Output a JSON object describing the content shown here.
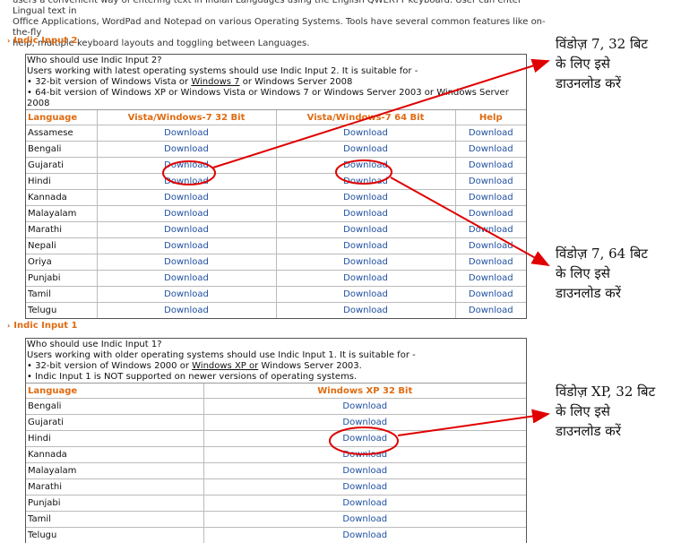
{
  "intro": {
    "line1": "users a convenient way of entering text in Indian Languages using the English QWERTY keyboard. User can enter Lingual text in",
    "line2": "Office Applications, WordPad and Notepad on various Operating Systems. Tools have several common features like on-the-fly",
    "line3": "help, multiple keyboard layouts and toggling between Languages."
  },
  "indic2": {
    "title": "Indic Input 2",
    "info_line1": "Who should use Indic Input 2?",
    "info_line2": "Users working with latest operating systems should use Indic Input 2. It is suitable for -",
    "bullet1_pre": "• 32-bit version of Windows Vista or ",
    "bullet1_ul": "Windows 7",
    "bullet1_post": " or Windows Server 2008",
    "bullet2": "• 64-bit version of Windows XP or Windows Vista or Windows 7 or Windows Server 2003 or Windows Server 2008",
    "headers": [
      "Language",
      "Vista/Windows-7 32 Bit",
      "Vista/Windows-7 64 Bit",
      "Help"
    ],
    "download_label": "Download",
    "languages": [
      "Assamese",
      "Bengali",
      "Gujarati",
      "Hindi",
      "Kannada",
      "Malayalam",
      "Marathi",
      "Nepali",
      "Oriya",
      "Punjabi",
      "Tamil",
      "Telugu"
    ]
  },
  "indic1": {
    "title": "Indic Input 1",
    "info_line1": "Who should use Indic Input 1?",
    "info_line2": "Users working with older operating systems should use Indic Input 1. It is suitable for -",
    "bullet1_pre": "• 32-bit version of Windows 2000 or ",
    "bullet1_ul": "Windows XP or",
    "bullet1_post": " Windows Server 2003.",
    "bullet2": "• Indic Input 1 is NOT supported on newer versions of operating systems.",
    "headers": [
      "Language",
      "Windows XP 32 Bit"
    ],
    "download_label": "Download",
    "languages": [
      "Bengali",
      "Gujarati",
      "Hindi",
      "Kannada",
      "Malayalam",
      "Marathi",
      "Punjabi",
      "Tamil",
      "Telugu"
    ]
  },
  "annotations": {
    "note1_line1": "विंडोज़ 7, 32 बिट",
    "note1_line2": "के लिए इसे",
    "note1_line3": "डाउनलोड करें",
    "note2_line1": "विंडोज़ 7, 64 बिट",
    "note2_line2": "के लिए इसे",
    "note2_line3": "डाउनलोड करें",
    "note3_line1": "विंडोज़ XP, 32 बिट",
    "note3_line2": "के लिए इसे",
    "note3_line3": "डाउनलोड करें"
  },
  "colors": {
    "accent": "#e06b10",
    "link": "#1f4fa0",
    "annotation": "#e00000"
  }
}
